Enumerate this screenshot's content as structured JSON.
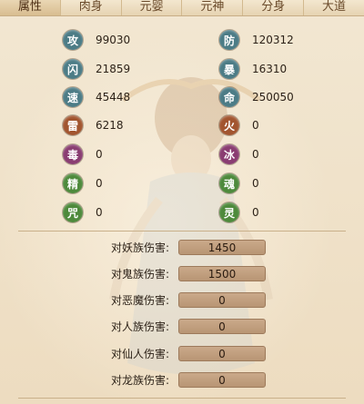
{
  "tabs": [
    {
      "label": "属性",
      "active": true
    },
    {
      "label": "肉身",
      "active": false
    },
    {
      "label": "元婴",
      "active": false
    },
    {
      "label": "元神",
      "active": false
    },
    {
      "label": "分身",
      "active": false
    },
    {
      "label": "大道",
      "active": false
    }
  ],
  "stats_left": [
    {
      "icon": "攻",
      "value": "99030",
      "color": "#4c7c86"
    },
    {
      "icon": "闪",
      "value": "21859",
      "color": "#4c7c86"
    },
    {
      "icon": "速",
      "value": "45448",
      "color": "#4c7c86"
    },
    {
      "icon": "雷",
      "value": "6218",
      "color": "#a2552f"
    },
    {
      "icon": "毒",
      "value": "0",
      "color": "#8a3d72"
    },
    {
      "icon": "精",
      "value": "0",
      "color": "#4e8a3c"
    },
    {
      "icon": "咒",
      "value": "0",
      "color": "#4e8a3c"
    }
  ],
  "stats_right": [
    {
      "icon": "防",
      "value": "120312",
      "color": "#4c7c86"
    },
    {
      "icon": "暴",
      "value": "16310",
      "color": "#4c7c86"
    },
    {
      "icon": "命",
      "value": "250050",
      "color": "#4c7c86"
    },
    {
      "icon": "火",
      "value": "0",
      "color": "#a2552f"
    },
    {
      "icon": "冰",
      "value": "0",
      "color": "#8a3d72"
    },
    {
      "icon": "魂",
      "value": "0",
      "color": "#4e8a3c"
    },
    {
      "icon": "灵",
      "value": "0",
      "color": "#4e8a3c"
    }
  ],
  "damage": [
    {
      "label": "对妖族伤害:",
      "value": "1450"
    },
    {
      "label": "对鬼族伤害:",
      "value": "1500"
    },
    {
      "label": "对恶魔伤害:",
      "value": "0"
    },
    {
      "label": "对人族伤害:",
      "value": "0"
    },
    {
      "label": "对仙人伤害:",
      "value": "0"
    },
    {
      "label": "对龙族伤害:",
      "value": "0"
    }
  ]
}
